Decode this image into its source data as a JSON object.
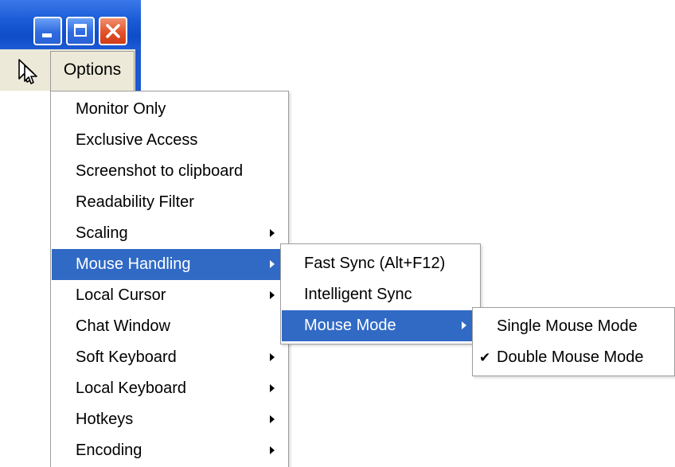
{
  "window": {
    "buttons": {
      "minimize_icon": "minimize-icon",
      "maximize_icon": "maximize-icon",
      "close_icon": "close-icon"
    },
    "titlebar_color": "#1b5cd6",
    "close_color": "#e2512b"
  },
  "menubar": {
    "tool_icon": "mouse-cursor-icon",
    "options_label": "Options"
  },
  "options_menu": {
    "items": [
      {
        "label": "Monitor Only",
        "has_submenu": false
      },
      {
        "label": "Exclusive Access",
        "has_submenu": false
      },
      {
        "label": "Screenshot to clipboard",
        "has_submenu": false
      },
      {
        "label": "Readability Filter",
        "has_submenu": false
      },
      {
        "label": "Scaling",
        "has_submenu": true
      },
      {
        "label": "Mouse Handling",
        "has_submenu": true,
        "selected": true
      },
      {
        "label": "Local Cursor",
        "has_submenu": true
      },
      {
        "label": "Chat Window",
        "has_submenu": false
      },
      {
        "label": "Soft Keyboard",
        "has_submenu": true
      },
      {
        "label": "Local Keyboard",
        "has_submenu": true
      },
      {
        "label": "Hotkeys",
        "has_submenu": true
      },
      {
        "label": "Encoding",
        "has_submenu": true
      }
    ]
  },
  "mouse_handling_menu": {
    "items": [
      {
        "label": "Fast Sync (Alt+F12)",
        "has_submenu": false
      },
      {
        "label": "Intelligent Sync",
        "has_submenu": false
      },
      {
        "label": "Mouse Mode",
        "has_submenu": true,
        "selected": true
      }
    ]
  },
  "mouse_mode_menu": {
    "items": [
      {
        "label": "Single Mouse Mode",
        "checked": false
      },
      {
        "label": "Double Mouse Mode",
        "checked": true
      }
    ],
    "check_glyph": "✔"
  },
  "colors": {
    "selection": "#316ac5",
    "menubar_bg": "#ece9d8"
  }
}
